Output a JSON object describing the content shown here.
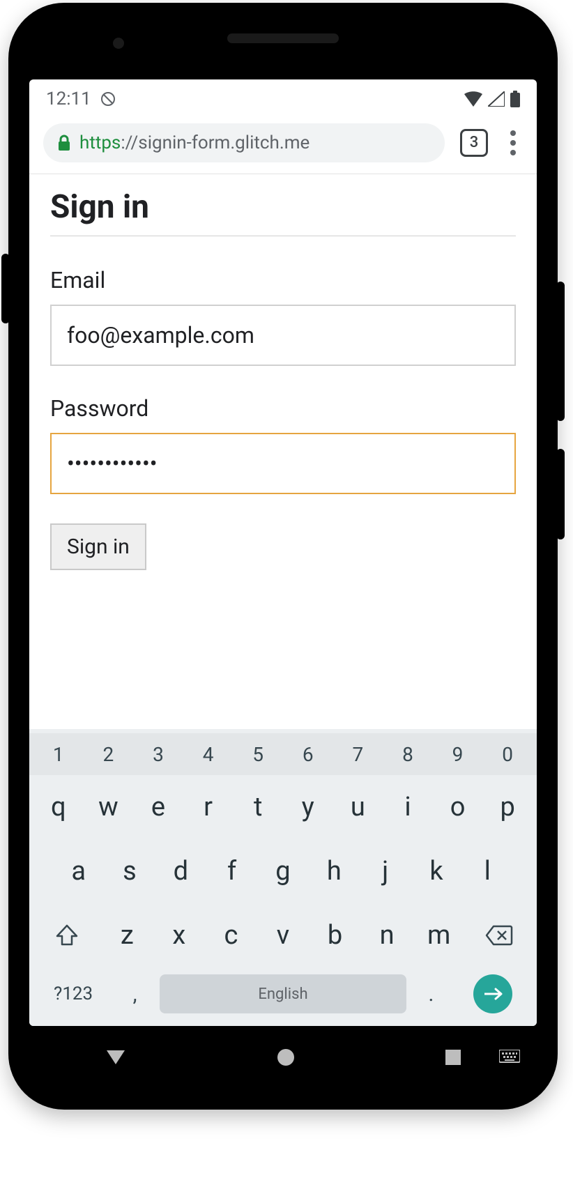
{
  "statusbar": {
    "time": "12:11"
  },
  "browser": {
    "url_scheme": "https",
    "url_sep": "://",
    "url_host": "signin-form.glitch.me",
    "tab_count": "3"
  },
  "page": {
    "heading": "Sign in",
    "email_label": "Email",
    "email_value": "foo@example.com",
    "password_label": "Password",
    "password_value": "••••••••••••",
    "submit_label": "Sign in"
  },
  "keyboard": {
    "num_row": [
      "1",
      "2",
      "3",
      "4",
      "5",
      "6",
      "7",
      "8",
      "9",
      "0"
    ],
    "row1": [
      "q",
      "w",
      "e",
      "r",
      "t",
      "y",
      "u",
      "i",
      "o",
      "p"
    ],
    "row2": [
      "a",
      "s",
      "d",
      "f",
      "g",
      "h",
      "j",
      "k",
      "l"
    ],
    "row3": [
      "z",
      "x",
      "c",
      "v",
      "b",
      "n",
      "m"
    ],
    "mode_label": "?123",
    "comma": ",",
    "space_label": "English",
    "period": "."
  }
}
